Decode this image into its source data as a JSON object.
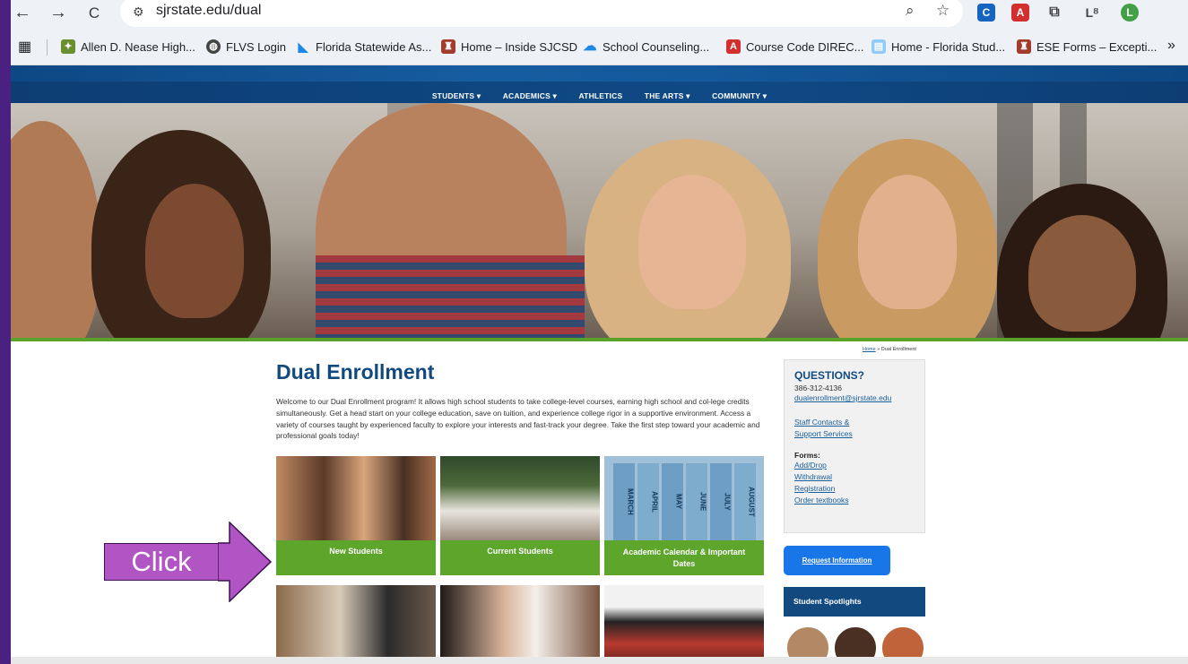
{
  "browser": {
    "url": "sjrstate.edu/dual",
    "nav": {
      "back": "←",
      "forward": "→",
      "reload": "C"
    },
    "extensions": [
      {
        "name": "c-extension",
        "glyph": "C",
        "color": "#1565c0"
      },
      {
        "name": "pdf-extension",
        "glyph": "A",
        "color": "#d32f2f"
      },
      {
        "name": "profile-avatar",
        "glyph": "L",
        "color": "#43a047"
      }
    ]
  },
  "bookmarks": [
    {
      "label": "Allen D. Nease High...",
      "icon": "school-crest-icon"
    },
    {
      "label": "FLVS Login",
      "icon": "globe-icon"
    },
    {
      "label": "Florida Statewide As...",
      "icon": "cambium-icon"
    },
    {
      "label": "Home – Inside SJCSD",
      "icon": "district-icon"
    },
    {
      "label": "School Counseling...",
      "icon": "cloud-icon"
    },
    {
      "label": "Course Code DIREC...",
      "icon": "pdf-icon"
    },
    {
      "label": "Home - Florida Stud...",
      "icon": "doc-icon"
    },
    {
      "label": "ESE Forms – Excepti...",
      "icon": "district-icon"
    },
    {
      "label": "»",
      "icon": "overflow"
    }
  ],
  "site": {
    "nav": [
      "STUDENTS ▾",
      "ACADEMICS ▾",
      "ATHLETICS",
      "THE ARTS ▾",
      "COMMUNITY ▾"
    ],
    "breadcrumb": {
      "home": "Home",
      "sep": " » ",
      "current": "Dual Enrollment"
    },
    "title": "Dual Enrollment",
    "intro": "Welcome to our Dual Enrollment program! It allows high school students to take college-level courses, earning high school and col-lege credits simultaneously. Get a head start on your college education, save on tuition, and experience college rigor in a supportive environment. Access a variety of courses taught by experienced faculty to explore your interests and fast-track your degree. Take the first step toward your academic and professional goals today!",
    "cards": [
      {
        "label": "New Students"
      },
      {
        "label": "Current Students"
      },
      {
        "label": "Academic Calendar & Important Dates"
      }
    ],
    "calendar_spines": [
      "MARCH",
      "APRIL",
      "MAY",
      "JUNE",
      "JULY",
      "AUGUST"
    ],
    "sidebar": {
      "title": "QUESTIONS?",
      "phone": "386-312-4136",
      "email": "dualenrollment@sjrstate.edu",
      "staff_link": "Staff Contacts & Support Services",
      "forms_label": "Forms:",
      "forms": [
        "Add/Drop",
        "Withdrawal",
        "Registration",
        "Order textbooks"
      ]
    },
    "request_button": "Request Information",
    "spotlights_title": "Student Spotlights"
  },
  "annotation": {
    "text": "Click",
    "color": "#b255c4"
  }
}
